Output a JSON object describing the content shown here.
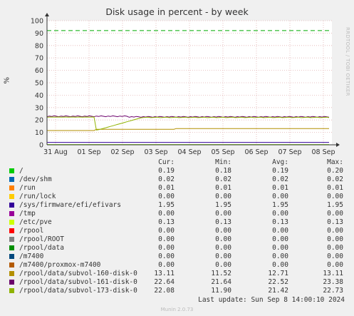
{
  "chart_data": {
    "type": "line",
    "title": "Disk usage in percent - by week",
    "ylabel": "%",
    "ylim": [
      0,
      100
    ],
    "yticks": [
      "0",
      "10",
      "20",
      "30",
      "40",
      "50",
      "60",
      "70",
      "80",
      "90",
      "100"
    ],
    "xticks": [
      "31 Aug",
      "01 Sep",
      "02 Sep",
      "03 Sep",
      "04 Sep",
      "05 Sep",
      "06 Sep",
      "07 Sep",
      "08 Sep"
    ],
    "warning_line": 92,
    "grid": true,
    "columns": [
      "Cur:",
      "Min:",
      "Avg:",
      "Max:"
    ],
    "series": [
      {
        "name": "/",
        "color": "#00cc00",
        "cur": "0.19",
        "min": "0.18",
        "avg": "0.19",
        "max": "0.20",
        "level": 0.19
      },
      {
        "name": "/dev/shm",
        "color": "#0066b3",
        "cur": "0.02",
        "min": "0.02",
        "avg": "0.02",
        "max": "0.02",
        "level": 0.02
      },
      {
        "name": "/run",
        "color": "#ff8000",
        "cur": "0.01",
        "min": "0.01",
        "avg": "0.01",
        "max": "0.01",
        "level": 0.01
      },
      {
        "name": "/run/lock",
        "color": "#ffcc00",
        "cur": "0.00",
        "min": "0.00",
        "avg": "0.00",
        "max": "0.00",
        "level": 0.0
      },
      {
        "name": "/sys/firmware/efi/efivars",
        "color": "#330099",
        "cur": "1.95",
        "min": "1.95",
        "avg": "1.95",
        "max": "1.95",
        "level": 1.95
      },
      {
        "name": "/tmp",
        "color": "#990099",
        "cur": "0.00",
        "min": "0.00",
        "avg": "0.00",
        "max": "0.00",
        "level": 0.0
      },
      {
        "name": "/etc/pve",
        "color": "#ccff00",
        "cur": "0.13",
        "min": "0.13",
        "avg": "0.13",
        "max": "0.13",
        "level": 0.13
      },
      {
        "name": "/rpool",
        "color": "#ff0000",
        "cur": "0.00",
        "min": "0.00",
        "avg": "0.00",
        "max": "0.00",
        "level": 0.0
      },
      {
        "name": "/rpool/ROOT",
        "color": "#808080",
        "cur": "0.00",
        "min": "0.00",
        "avg": "0.00",
        "max": "0.00",
        "level": 0.0
      },
      {
        "name": "/rpool/data",
        "color": "#008f00",
        "cur": "0.00",
        "min": "0.00",
        "avg": "0.00",
        "max": "0.00",
        "level": 0.0
      },
      {
        "name": "/m7400",
        "color": "#00487d",
        "cur": "0.00",
        "min": "0.00",
        "avg": "0.00",
        "max": "0.00",
        "level": 0.0
      },
      {
        "name": "/m7400/proxmox-m7400",
        "color": "#b35a00",
        "cur": "0.00",
        "min": "0.00",
        "avg": "0.00",
        "max": "0.00",
        "level": 0.0
      },
      {
        "name": "/rpool/data/subvol-160-disk-0",
        "color": "#b38f00",
        "cur": "13.11",
        "min": "11.52",
        "avg": "12.71",
        "max": "13.11",
        "level": 13.11
      },
      {
        "name": "/rpool/data/subvol-161-disk-0",
        "color": "#6b006b",
        "cur": "22.64",
        "min": "21.64",
        "avg": "22.52",
        "max": "23.38",
        "level": 22.64
      },
      {
        "name": "/rpool/data/subvol-173-disk-0",
        "color": "#8fb300",
        "cur": "22.08",
        "min": "11.90",
        "avg": "21.42",
        "max": "22.73",
        "level": 22.08
      }
    ]
  },
  "watermark": "RRDTOOL / TOBI OETIKER",
  "last_update": "Last update: Sun Sep  8 14:00:10 2024",
  "munin_version": "Munin 2.0.73"
}
